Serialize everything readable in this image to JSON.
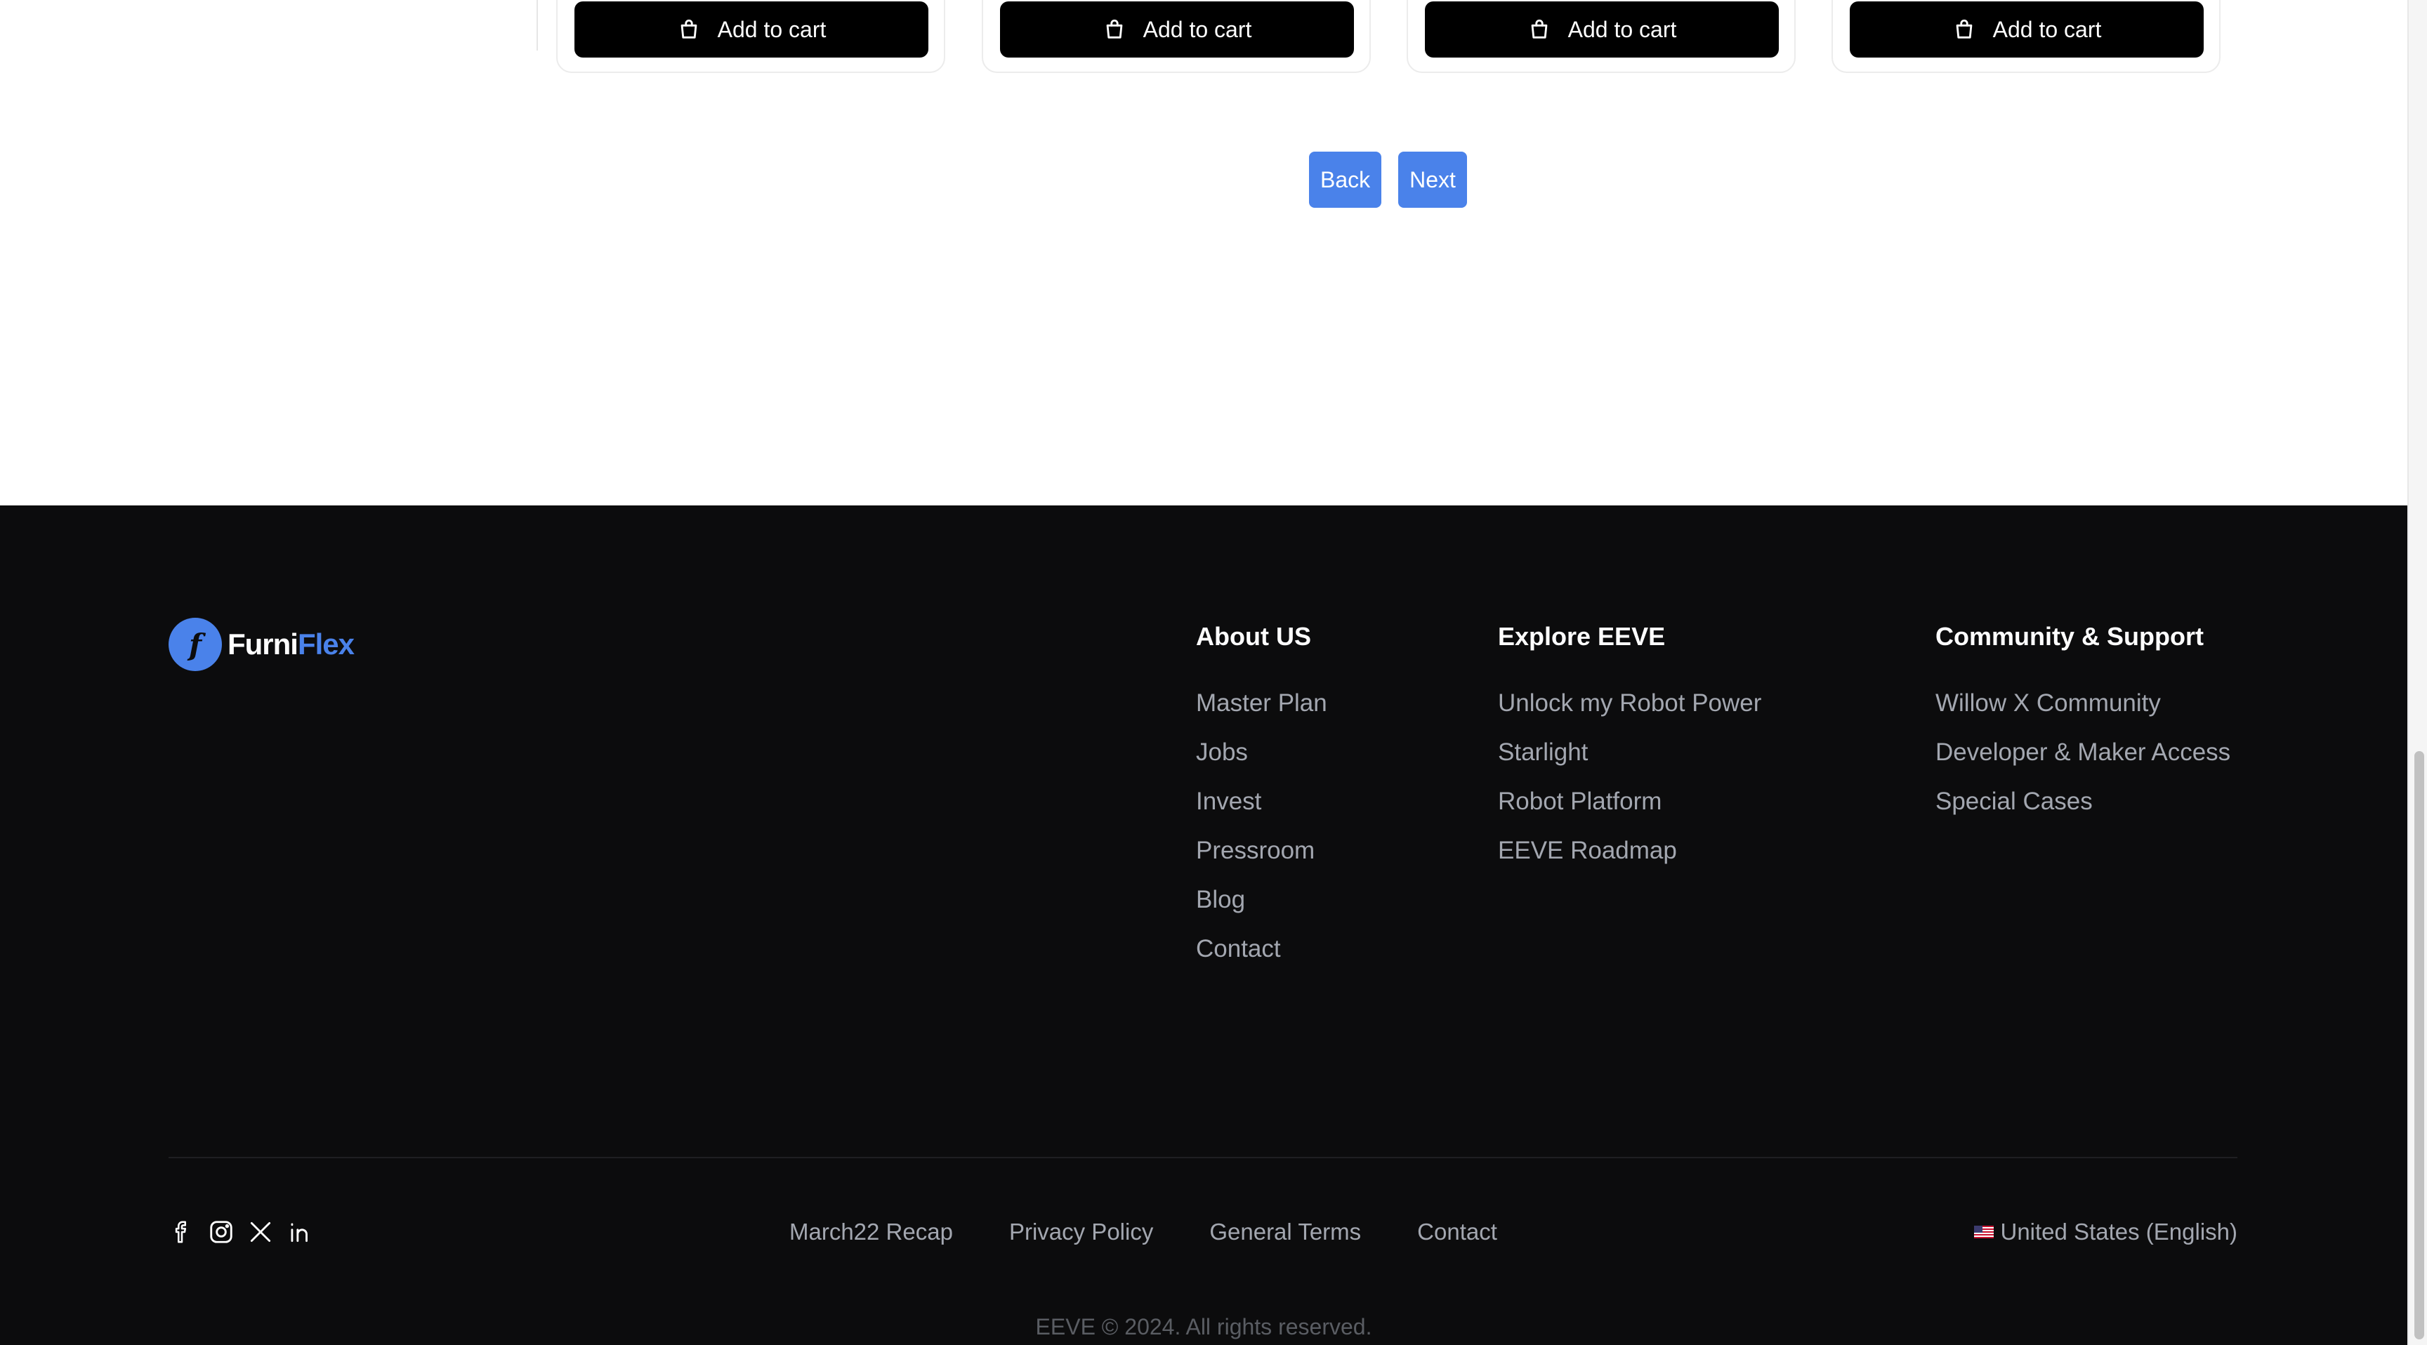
{
  "products": {
    "cart_label": "Add to cart",
    "cards": [
      {
        "button": "Add to cart"
      },
      {
        "button": "Add to cart"
      },
      {
        "button": "Add to cart"
      },
      {
        "button": "Add to cart"
      }
    ]
  },
  "pagination": {
    "back": "Back",
    "next": "Next"
  },
  "footer": {
    "logo": {
      "mark": "f",
      "name_part1": "Furni",
      "name_part2": "Flex"
    },
    "columns": [
      {
        "title": "About US",
        "links": [
          "Master Plan",
          "Jobs",
          "Invest",
          "Pressroom",
          "Blog",
          "Contact"
        ]
      },
      {
        "title": "Explore EEVE",
        "links": [
          "Unlock my Robot Power",
          "Starlight",
          "Robot Platform",
          "EEVE Roadmap"
        ]
      },
      {
        "title": "Community & Support",
        "links": [
          "Willow X Community",
          "Developer & Maker Access",
          "Special Cases"
        ]
      }
    ],
    "socials": [
      "facebook-icon",
      "instagram-icon",
      "x-icon",
      "linkedin-icon"
    ],
    "bottom_links": [
      "March22 Recap",
      "Privacy Policy",
      "General Terms",
      "Contact"
    ],
    "locale": "United States (English)",
    "copyright": "EEVE © 2024. All rights reserved."
  },
  "colors": {
    "accent": "#4a82ea",
    "footer_bg": "#0c0c0d",
    "muted_text": "#a3a7b0"
  }
}
